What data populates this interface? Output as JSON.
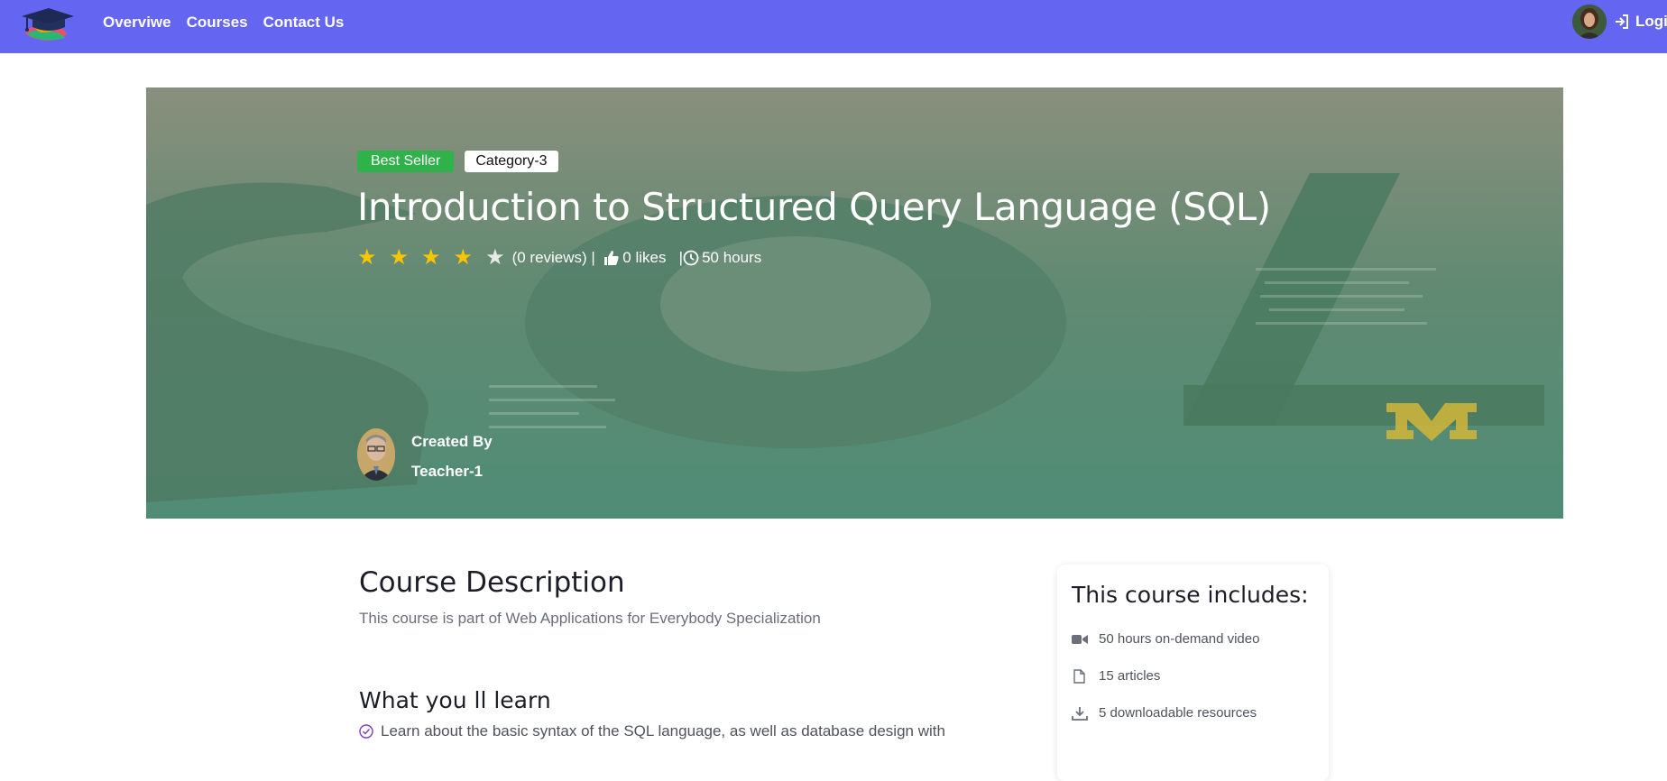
{
  "nav": {
    "links": [
      "Overviwe",
      "Courses",
      "Contact Us"
    ],
    "login_label": "Login"
  },
  "hero": {
    "badge_best": "Best Seller",
    "badge_category": "Category-3",
    "title": "Introduction to Structured Query Language (SQL)",
    "rating": 4,
    "rating_max": 5,
    "reviews": "(0 reviews)",
    "likes": "0 likes",
    "duration": "50 hours",
    "created_by_label": "Created By",
    "teacher": "Teacher-1"
  },
  "description": {
    "title": "Course Description",
    "text": "This course is part of Web Applications for Everybody Specialization",
    "learn_title": "What you ll learn",
    "learn_items": [
      "Learn about the basic syntax of the SQL language, as well as database design with"
    ]
  },
  "includes": {
    "title": "This course includes:",
    "items": [
      "50 hours on-demand video",
      "15 articles",
      "5 downloadable resources"
    ]
  },
  "colors": {
    "navbar": "#6466f1",
    "badge_best": "#2fb24a",
    "star": "#f7c600",
    "check": "#7b3fbf"
  }
}
